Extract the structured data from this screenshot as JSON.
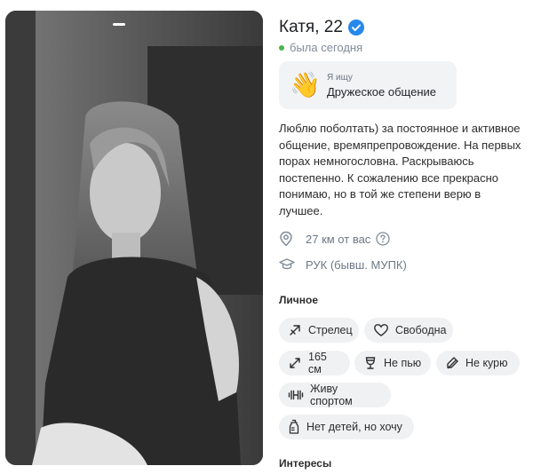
{
  "profile": {
    "name_age": "Катя, 22",
    "status": "была сегодня",
    "looking_for": {
      "label": "Я ищу",
      "value": "Дружеское общение",
      "icon": "waving-hand-icon"
    },
    "about": "Люблю поболтать) за постоянное и активное общение, времяпрепровождение. На первых порах немногословна. Раскрываюсь постепенно. К сожалению все прекрасно понимаю, но в той же степени верю в лучшее.",
    "distance": "27 км от вас",
    "education": "РУК (бывш. МУПК)"
  },
  "sections": {
    "personal": "Личное",
    "interests": "Интересы"
  },
  "personal_chips": [
    {
      "label": "Стрелец",
      "icon": "sagittarius-icon"
    },
    {
      "label": "Свободна",
      "icon": "heart-icon"
    },
    {
      "label": "165 см",
      "icon": "height-arrows-icon"
    },
    {
      "label": "Не пью",
      "icon": "wine-glass-icon"
    },
    {
      "label": "Не курю",
      "icon": "no-smoking-icon"
    },
    {
      "label": "Живу спортом",
      "icon": "dumbbell-icon"
    },
    {
      "label": "Нет детей, но хочу",
      "icon": "baby-bottle-icon"
    }
  ],
  "colors": {
    "online": "#4bb34b",
    "verified": "#2688eb",
    "chip_bg": "#f0f1f3",
    "muted_text": "#6d7885"
  }
}
